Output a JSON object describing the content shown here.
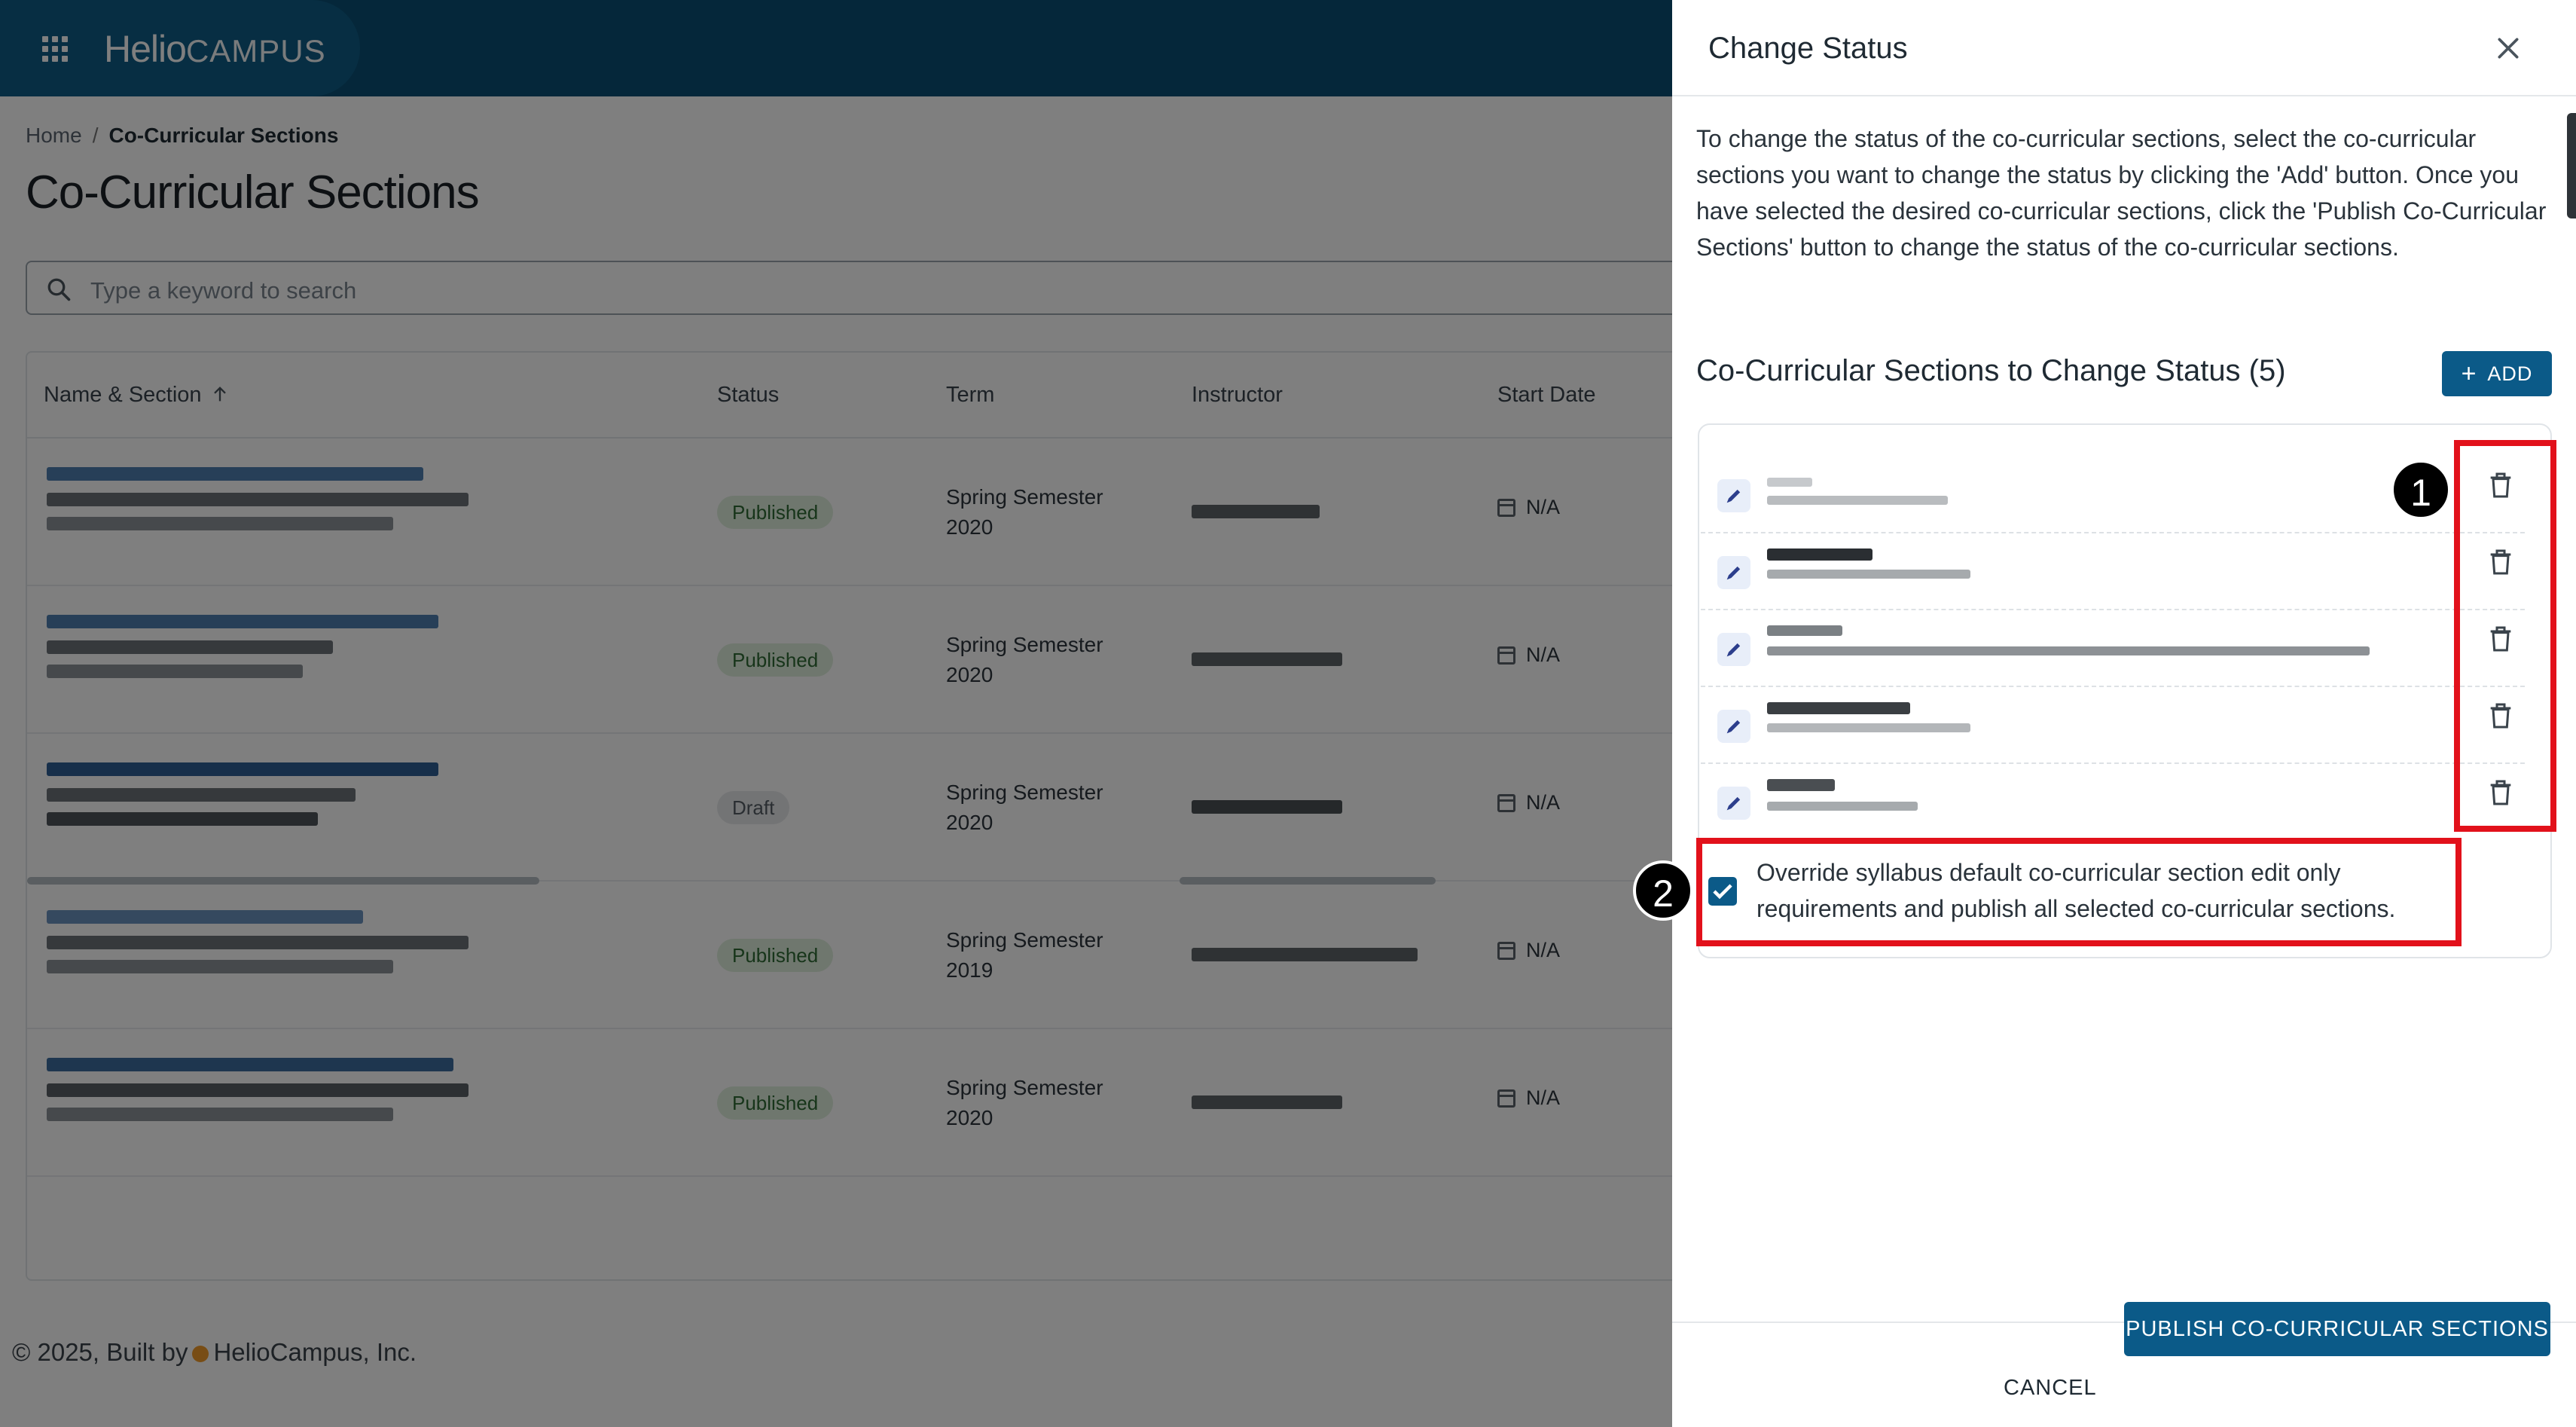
{
  "app": {
    "brand_main": "Helio",
    "brand_sub": "CAMPUS"
  },
  "breadcrumb": {
    "home": "Home",
    "separator": "/",
    "current": "Co-Curricular Sections"
  },
  "page_title": "Co-Curricular Sections",
  "search": {
    "placeholder": "Type a keyword to search"
  },
  "table": {
    "headers": {
      "name": "Name & Section",
      "status": "Status",
      "term": "Term",
      "instructor": "Instructor",
      "start_date": "Start Date"
    },
    "rows": [
      {
        "status": "Published",
        "status_kind": "published",
        "term_line1": "Spring Semester",
        "term_line2": "2020",
        "start_date": "N/A"
      },
      {
        "status": "Published",
        "status_kind": "published",
        "term_line1": "Spring Semester",
        "term_line2": "2020",
        "start_date": "N/A"
      },
      {
        "status": "Draft",
        "status_kind": "draft",
        "term_line1": "Spring Semester",
        "term_line2": "2020",
        "start_date": "N/A"
      },
      {
        "status": "Published",
        "status_kind": "published",
        "term_line1": "Spring Semester",
        "term_line2": "2019",
        "start_date": "N/A"
      },
      {
        "status": "Published",
        "status_kind": "published",
        "term_line1": "Spring Semester",
        "term_line2": "2020",
        "start_date": "N/A"
      }
    ]
  },
  "footer": {
    "prefix": "© 2025, Built by",
    "company": "HelioCampus, Inc."
  },
  "drawer": {
    "title": "Change Status",
    "description": "To change the status of the co-curricular sections, select the co-curricular sections you want to change the status by clicking the 'Add' button. Once you have selected the desired co-curricular sections, click the 'Publish Co-Curricular Sections' button to change the status of the co-curricular sections.",
    "section_title": "Co-Curricular Sections to Change Status (5)",
    "add_label": "ADD",
    "override_label": "Override syllabus default co-curricular section edit only requirements and publish all selected co-curricular sections.",
    "override_checked": true,
    "cancel_label": "CANCEL",
    "publish_label": "PUBLISH CO-CURRICULAR SECTIONS"
  },
  "annotations": {
    "marker_1": "1",
    "marker_2": "2"
  },
  "colors": {
    "brand_dark": "#0b4f74",
    "primary_button": "#0b5a88",
    "annotation_red": "#e2111b",
    "published_bg": "#dfeedd",
    "published_text": "#2f6b34"
  }
}
